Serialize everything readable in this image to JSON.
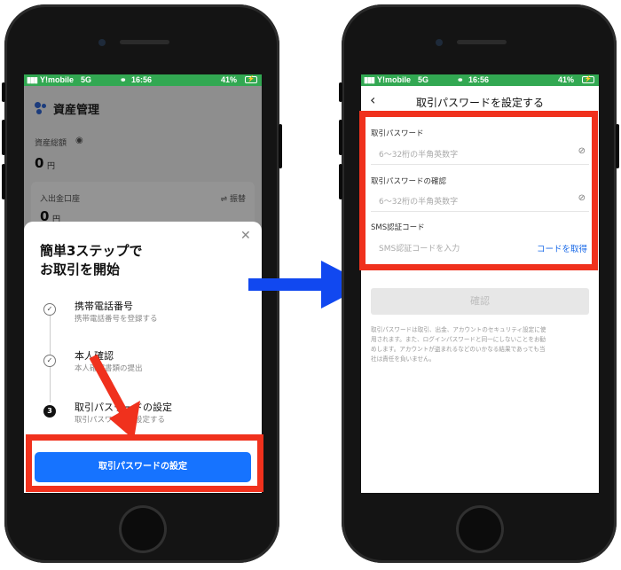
{
  "left_screen": {
    "status": {
      "carrier": "Y!mobile",
      "network": "5G",
      "time": "16:56",
      "battery": "41%"
    },
    "header": {
      "title": "資産管理"
    },
    "background": {
      "total_label": "資産総額",
      "total_value": "0",
      "total_unit": "円",
      "account_label": "入出金口座",
      "account_switch": "⇌ 振替",
      "account_value": "0",
      "account_unit": "円"
    },
    "sheet": {
      "title_line1": "簡単3ステップで",
      "title_line2": "お取引を開始",
      "steps": [
        {
          "title": "携帯電話番号",
          "subtitle": "携帯電話番号を登録する",
          "marker": "✓"
        },
        {
          "title": "本人確認",
          "subtitle": "本人確認書類の提出",
          "marker": "✓"
        },
        {
          "title": "取引パスワードの設定",
          "subtitle": "取引パスワードを設定する",
          "marker": "3"
        }
      ],
      "primary_button": "取引パスワードの設定"
    }
  },
  "right_screen": {
    "status": {
      "carrier": "Y!mobile",
      "network": "5G",
      "time": "16:56",
      "battery": "41%"
    },
    "nav": {
      "title": "取引パスワードを設定する"
    },
    "fields": {
      "password_label": "取引パスワード",
      "password_placeholder": "6～32桁の半角英数字",
      "confirm_label": "取引パスワードの確認",
      "confirm_placeholder": "6～32桁の半角英数字",
      "sms_label": "SMS認証コード",
      "sms_placeholder": "SMS認証コードを入力",
      "sms_get_code": "コードを取得"
    },
    "confirm_button": "確認",
    "notice_lines": [
      "取引パスワードは取引、出金、アカウントのセキュリティ設定に使",
      "用されます。また、ログインパスワードと同一にしないことをお勧",
      "めします。アカウントが盗まれるなどのいかなる結果であっても当",
      "社は責任を負いません。"
    ]
  },
  "colors": {
    "status_green": "#32a852",
    "primary_blue": "#1673ff",
    "link_blue": "#1a6ae8",
    "highlight_red": "#f0311d",
    "arrow_blue": "#1148f0"
  }
}
